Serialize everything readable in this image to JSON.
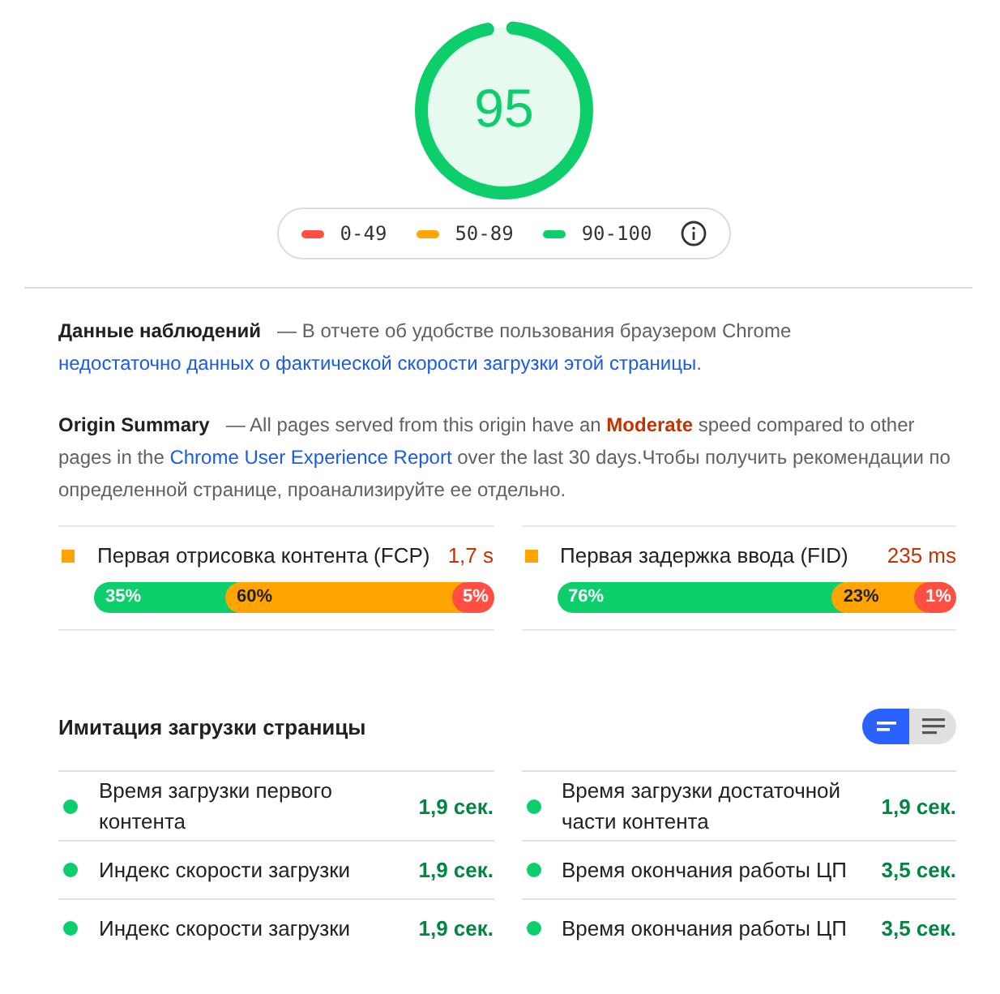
{
  "gauge": {
    "score": "95"
  },
  "legend": [
    {
      "kind": "fail",
      "label": "0-49"
    },
    {
      "kind": "average",
      "label": "50-89"
    },
    {
      "kind": "pass",
      "label": "90-100"
    }
  ],
  "field_data": {
    "title": "Данные наблюдений",
    "parts": [
      {
        "kind": "plain",
        "text": "— В отчете об удобстве пользования браузером Chrome "
      },
      {
        "kind": "link",
        "text": "недостаточно данных о фактической скорости загрузки этой страницы"
      },
      {
        "kind": "plain",
        "text": "."
      }
    ]
  },
  "origin_summary": {
    "title": "Origin Summary",
    "parts": [
      {
        "kind": "plain",
        "text": "— All pages served from this origin have an "
      },
      {
        "kind": "rating",
        "text": "Moderate"
      },
      {
        "kind": "plain",
        "text": " speed compared to other pages in the "
      },
      {
        "kind": "link",
        "text": "Chrome User Experience Report"
      },
      {
        "kind": "plain",
        "text": " over the last 30 days.Чтобы получить рекомендации по определенной странице, проанализируйте ее отдельно."
      }
    ]
  },
  "field_metrics": [
    {
      "label": "Первая отрисовка контента (FCP)",
      "value": "1,7 s",
      "color": "#ffa400",
      "segments": [
        {
          "kind": "fast",
          "label": "35%"
        },
        {
          "kind": "average",
          "label": "60%"
        },
        {
          "kind": "slow",
          "label": "5%"
        }
      ]
    },
    {
      "label": "Первая задержка ввода (FID)",
      "value": "235 ms",
      "color": "#ffa400",
      "segments": [
        {
          "kind": "fast",
          "label": "76%"
        },
        {
          "kind": "average",
          "label": "23%"
        },
        {
          "kind": "slow",
          "label": "1%"
        }
      ]
    }
  ],
  "lab_data": {
    "title": "Имитация загрузки страницы",
    "view_toggle": [
      {
        "kind": "summary",
        "selected": true
      },
      {
        "kind": "list",
        "selected": false
      }
    ],
    "metrics": [
      {
        "label": "Время загрузки первого контента",
        "value": "1,9 сек.",
        "color": "#0cce6b"
      },
      {
        "label": "Время загрузки достаточной части контента",
        "value": "1,9 сек.",
        "color": "#0cce6b"
      },
      {
        "label": "Индекс скорости загрузки",
        "value": "1,9 сек.",
        "color": "#0cce6b"
      },
      {
        "label": "Время окончания работы ЦП",
        "value": "3,5 сек.",
        "color": "#0cce6b"
      },
      {
        "label": "Индекс скорости загрузки",
        "value": "1,9 сек.",
        "color": "#0cce6b"
      },
      {
        "label": "Время окончания работы ЦП",
        "value": "3,5 сек.",
        "color": "#0cce6b"
      }
    ]
  }
}
